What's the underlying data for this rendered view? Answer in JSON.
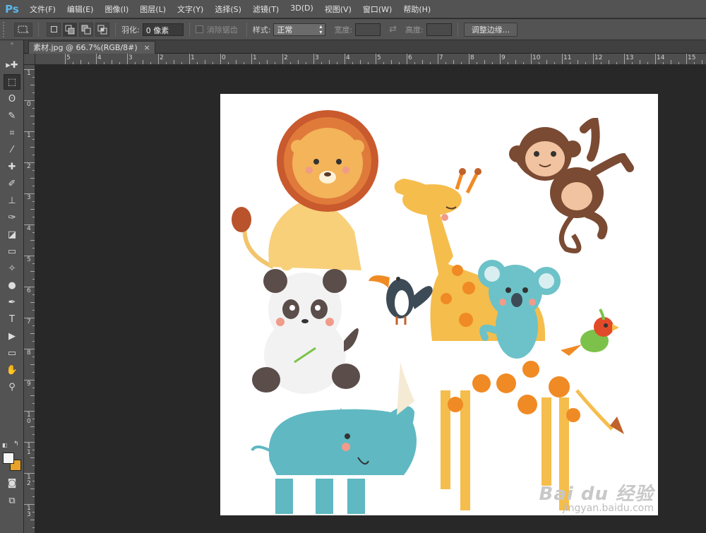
{
  "app": {
    "logo": "Ps"
  },
  "menu": [
    "文件(F)",
    "编辑(E)",
    "图像(I)",
    "图层(L)",
    "文字(Y)",
    "选择(S)",
    "滤镜(T)",
    "3D(D)",
    "视图(V)",
    "窗口(W)",
    "帮助(H)"
  ],
  "options": {
    "feather_label": "羽化:",
    "feather_value": "0 像素",
    "antialias_label": "消除锯齿",
    "style_label": "样式:",
    "style_value": "正常",
    "width_label": "宽度:",
    "height_label": "高度:",
    "refine_button": "调整边缘..."
  },
  "document": {
    "tab_title": "素材.jpg @ 66.7%(RGB/8#)",
    "close_glyph": "×"
  },
  "rulers": {
    "horizontal": [
      "5",
      "4",
      "3",
      "2",
      "1",
      "0",
      "1",
      "2",
      "3",
      "4",
      "5",
      "6",
      "7",
      "8",
      "9",
      "10",
      "11",
      "12",
      "13",
      "14",
      "15"
    ],
    "vertical": [
      "1",
      "0",
      "1",
      "2",
      "3",
      "4",
      "5",
      "6",
      "7",
      "8",
      "9",
      "1\n0",
      "1\n1",
      "1\n2",
      "1\n3"
    ]
  },
  "tools": [
    "move-icon",
    "marquee-icon",
    "lasso-icon",
    "quick-select-icon",
    "crop-icon",
    "eyedropper-icon",
    "healing-icon",
    "brush-icon",
    "stamp-icon",
    "history-brush-icon",
    "eraser-icon",
    "gradient-icon",
    "blur-icon",
    "dodge-icon",
    "pen-icon",
    "type-icon",
    "path-select-icon",
    "rectangle-icon",
    "hand-icon",
    "zoom-icon"
  ],
  "tool_glyphs": [
    "▸✚",
    "⬚",
    "ʘ",
    "✎",
    "⌗",
    "⁄",
    "✚",
    "✐",
    "⊥",
    "✑",
    "◪",
    "▭",
    "✧",
    "●",
    "✒",
    "T",
    "▶",
    "▭",
    "✋",
    "⚲"
  ],
  "colors": {
    "foreground": "#f6f6f6",
    "background": "#e7a329"
  },
  "watermark": {
    "main": "Bai du 经验",
    "sub": "jingyan.baidu.com"
  }
}
